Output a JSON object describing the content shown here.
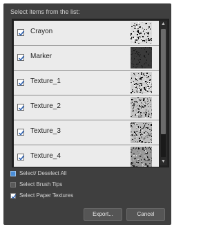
{
  "dialog": {
    "header_label": "Select items from the list:"
  },
  "items": [
    {
      "label": "Crayon",
      "checked": true,
      "thumb": "crayon"
    },
    {
      "label": "Marker",
      "checked": true,
      "thumb": "marker"
    },
    {
      "label": "Texture_1",
      "checked": true,
      "thumb": "texture1"
    },
    {
      "label": "Texture_2",
      "checked": true,
      "thumb": "texture2"
    },
    {
      "label": "Texture_3",
      "checked": true,
      "thumb": "texture3"
    },
    {
      "label": "Texture_4",
      "checked": true,
      "thumb": "texture4"
    }
  ],
  "scrollbar": {
    "up_icon": "chevron-up-icon",
    "down_icon": "chevron-down-icon",
    "position": 0,
    "visible_fraction": 0.82
  },
  "options": {
    "select_all": {
      "label": "Select/ Deselect All",
      "state": "partial"
    },
    "brush_tips": {
      "label": "Select Brush Tips",
      "checked": false
    },
    "paper_textures": {
      "label": "Select Paper Textures",
      "checked": true
    }
  },
  "buttons": {
    "export": "Export...",
    "cancel": "Cancel"
  },
  "colors": {
    "dialog_bg": "#3f3f3f",
    "row_bg": "#ebebeb",
    "accent_blue": "#4a8ed8"
  }
}
